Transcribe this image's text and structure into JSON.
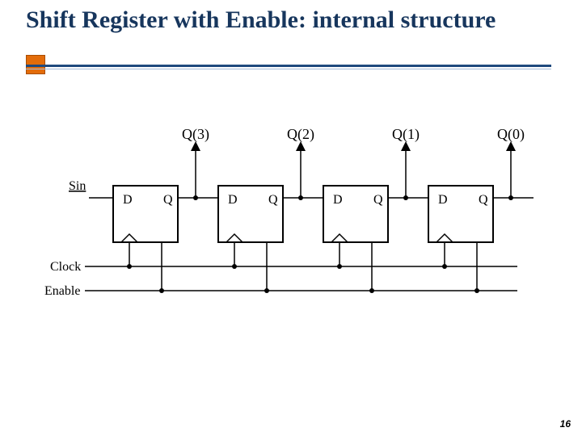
{
  "title": "Shift Register with Enable: internal structure",
  "page_number": "16",
  "signals": {
    "sin": "Sin",
    "clock": "Clock",
    "enable": "Enable"
  },
  "outputs": [
    "Q(3)",
    "Q(2)",
    "Q(1)",
    "Q(0)"
  ],
  "flipflops": [
    {
      "d": "D",
      "q": "Q"
    },
    {
      "d": "D",
      "q": "Q"
    },
    {
      "d": "D",
      "q": "Q"
    },
    {
      "d": "D",
      "q": "Q"
    }
  ]
}
